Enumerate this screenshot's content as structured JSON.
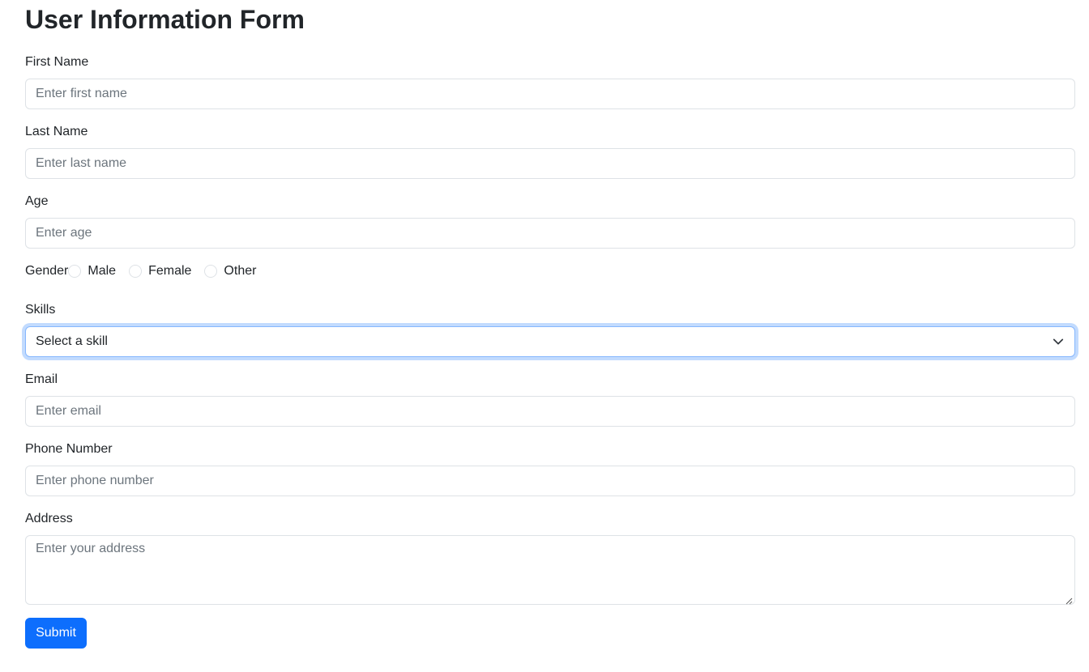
{
  "form": {
    "title": "User Information Form",
    "first_name": {
      "label": "First Name",
      "placeholder": "Enter first name",
      "value": ""
    },
    "last_name": {
      "label": "Last Name",
      "placeholder": "Enter last name",
      "value": ""
    },
    "age": {
      "label": "Age",
      "placeholder": "Enter age",
      "value": ""
    },
    "gender": {
      "label": "Gender",
      "options": [
        "Male",
        "Female",
        "Other"
      ]
    },
    "skills": {
      "label": "Skills",
      "selected": "Select a skill"
    },
    "email": {
      "label": "Email",
      "placeholder": "Enter email",
      "value": ""
    },
    "phone": {
      "label": "Phone Number",
      "placeholder": "Enter phone number",
      "value": ""
    },
    "address": {
      "label": "Address",
      "placeholder": "Enter your address",
      "value": ""
    },
    "submit_label": "Submit"
  },
  "colors": {
    "primary": "#0d6efd",
    "border": "#dee2e6",
    "focus_border": "#86b7fe",
    "text": "#212529",
    "placeholder": "#6c757d"
  },
  "icons": {
    "select_chevron": "chevron-down-icon",
    "textarea_resize": "resize-handle-icon"
  }
}
